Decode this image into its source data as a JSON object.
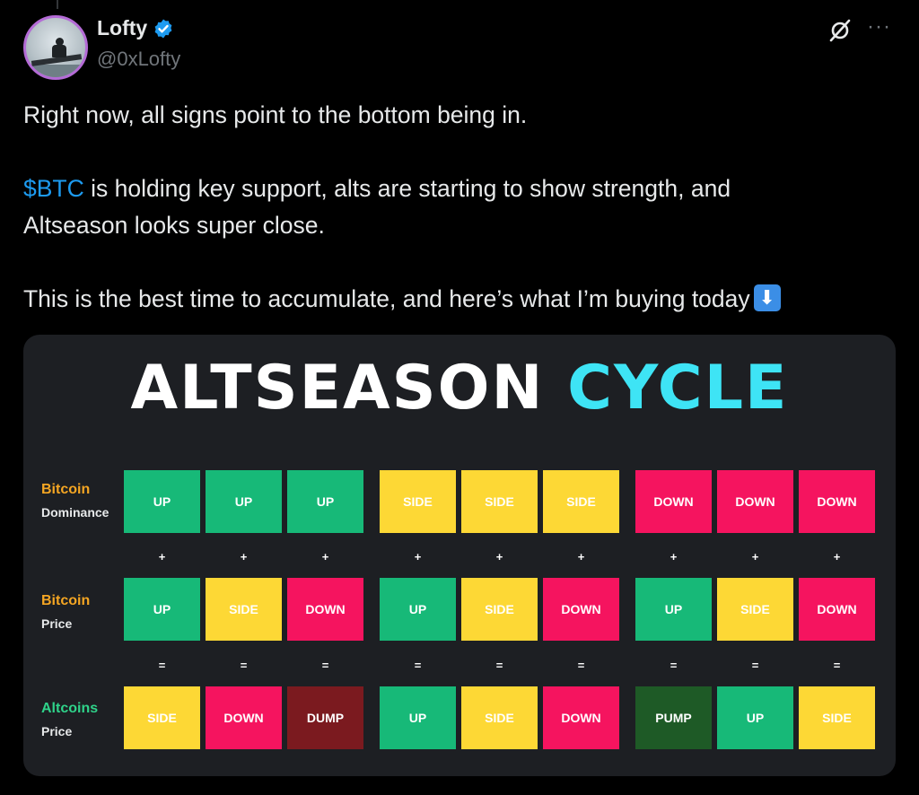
{
  "author": {
    "display_name": "Lofty",
    "handle": "@0xLofty",
    "verified": true
  },
  "icons": {
    "verified": "verified-badge-icon",
    "grok": "grok-icon",
    "more": "more-options-icon"
  },
  "tweet": {
    "line1": "Right now, all signs point to the bottom being in.",
    "cashtag": "$BTC",
    "line2_rest": " is holding key support, alts are starting to show strength, and",
    "line3": "Altseason looks super close.",
    "line4": "This is the best time to accumulate, and here’s what I’m buying today"
  },
  "infographic": {
    "title_main": "ALTSEASON",
    "title_accent": "CYCLE",
    "colors": {
      "UP": "#17b978",
      "SIDE": "#fdd835",
      "DOWN": "#f5145f",
      "DUMP": "#7b1a1f",
      "PUMP": "#1e5a26",
      "accent": "#3ee4f5",
      "bitcoin_label": "#f5a623",
      "altcoins_label": "#2fd38a"
    },
    "rows": [
      {
        "label1": "Bitcoin",
        "label2": "Dominance",
        "label_color": "bitcoin",
        "cells": [
          "UP",
          "UP",
          "UP",
          "SIDE",
          "SIDE",
          "SIDE",
          "DOWN",
          "DOWN",
          "DOWN"
        ]
      },
      {
        "label1": "Bitcoin",
        "label2": "Price",
        "label_color": "bitcoin",
        "cells": [
          "UP",
          "SIDE",
          "DOWN",
          "UP",
          "SIDE",
          "DOWN",
          "UP",
          "SIDE",
          "DOWN"
        ]
      },
      {
        "label1": "Altcoins",
        "label2": "Price",
        "label_color": "altcoins",
        "cells": [
          "SIDE",
          "DOWN",
          "DUMP",
          "UP",
          "SIDE",
          "DOWN",
          "PUMP",
          "UP",
          "SIDE"
        ]
      }
    ],
    "operators": [
      "+",
      "="
    ]
  }
}
